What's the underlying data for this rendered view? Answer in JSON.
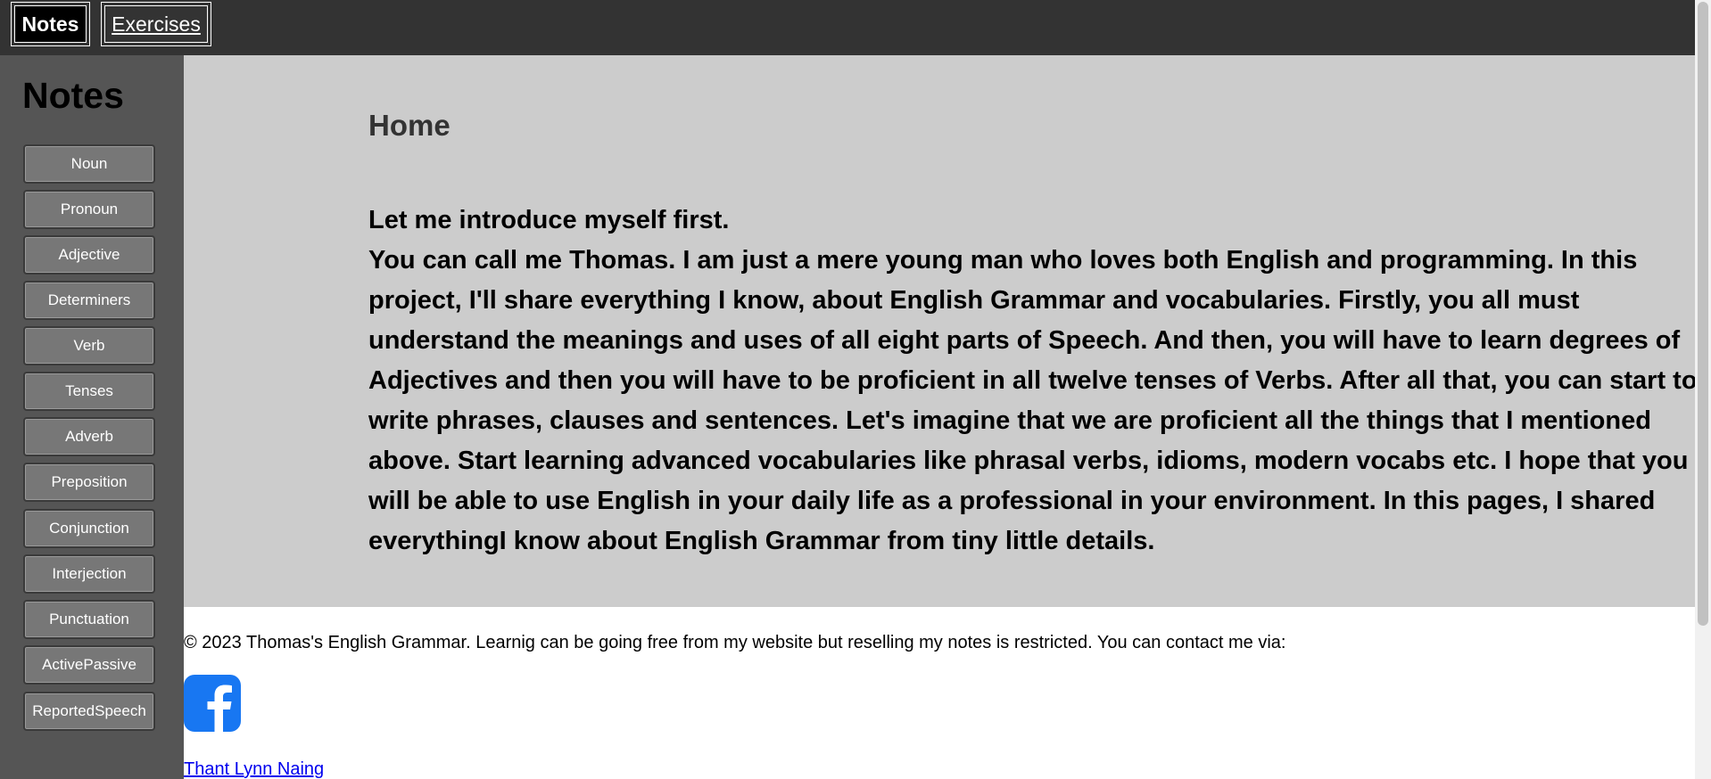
{
  "topnav": {
    "tabs": [
      {
        "label": "Notes",
        "active": true
      },
      {
        "label": "Exercises",
        "active": false
      }
    ]
  },
  "sidebar": {
    "title": "Notes",
    "items": [
      {
        "label": "Noun"
      },
      {
        "label": "Pronoun"
      },
      {
        "label": "Adjective"
      },
      {
        "label": "Determiners"
      },
      {
        "label": "Verb"
      },
      {
        "label": "Tenses"
      },
      {
        "label": "Adverb"
      },
      {
        "label": "Preposition"
      },
      {
        "label": "Conjunction"
      },
      {
        "label": "Interjection"
      },
      {
        "label": "Punctuation"
      },
      {
        "label": "ActivePassive"
      },
      {
        "label": "ReportedSpeech"
      }
    ]
  },
  "main": {
    "title": "Home",
    "intro_heading": "Let me introduce myself first.",
    "intro_body": "You can call me Thomas. I am just a mere young man who loves both English and programming. In this project, I'll share everything I know, about English Grammar and vocabularies. Firstly, you all must understand the meanings and uses of all eight parts of Speech. And then, you will have to learn degrees of Adjectives and then you will have to be proficient in all twelve tenses of Verbs. After all that, you can start to write phrases, clauses and sentences. Let's imagine that we are proficient all the things that I mentioned above. Start learning advanced vocabularies like phrasal verbs, idioms, modern vocabs etc. I hope that you will be able to use English in your daily life as a professional in your environment. In this pages, I shared everythingI know about English Grammar from tiny little details."
  },
  "footer": {
    "copyright": "© 2023 Thomas's English Grammar. Learnig can be going free from my website but reselling my notes is restricted. You can contact me via:",
    "social_icon": "facebook-icon",
    "link_text": "Thant Lynn Naing"
  },
  "colors": {
    "topbar_bg": "#333333",
    "sidebar_bg": "#555555",
    "sidebar_button_bg": "#777777",
    "main_bg": "#cccccc",
    "facebook_blue": "#1877f2",
    "link": "#0000ee"
  }
}
